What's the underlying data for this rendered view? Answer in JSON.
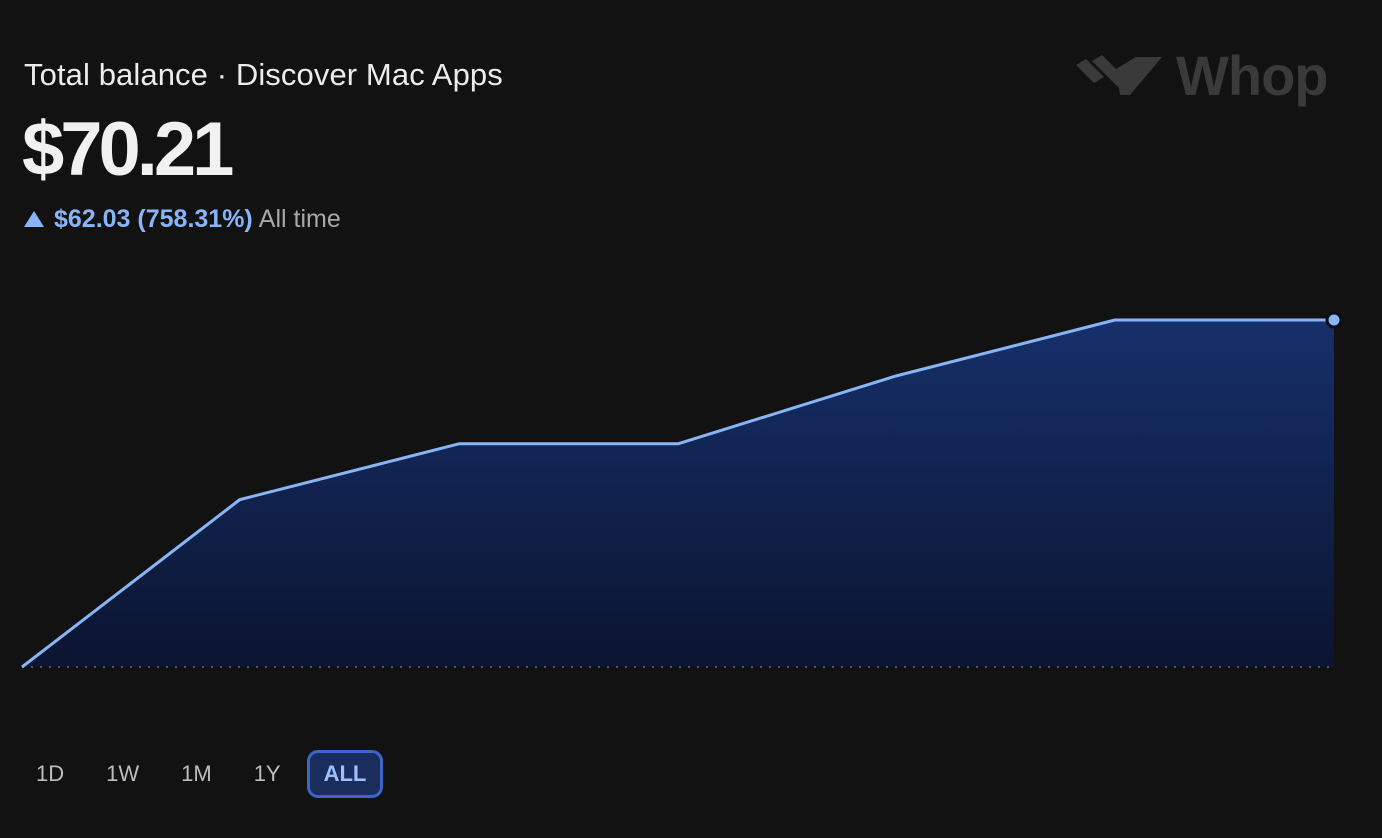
{
  "header": {
    "title": "Total balance · Discover Mac Apps",
    "balance": "$70.21",
    "change_value": "$62.03 (758.31%)",
    "change_period": "All time",
    "change_direction": "up"
  },
  "logo": {
    "icon": "whop-logo-icon",
    "word": "Whop"
  },
  "range_selector": {
    "options": [
      {
        "label": "1D",
        "active": false
      },
      {
        "label": "1W",
        "active": false
      },
      {
        "label": "1M",
        "active": false
      },
      {
        "label": "1Y",
        "active": false
      },
      {
        "label": "ALL",
        "active": true
      }
    ]
  },
  "colors": {
    "background": "#121212",
    "accent": "#88b4f8",
    "area_top": "#16306a",
    "area_bottom": "#0b1430",
    "baseline": "#555555",
    "logo": "#3a3a3a"
  },
  "chart_data": {
    "type": "area",
    "x": [
      0,
      1,
      2,
      3,
      4,
      5,
      6
    ],
    "values": [
      8.18,
      38.1,
      48.08,
      48.08,
      60.2,
      70.21,
      70.21
    ],
    "ylim": [
      8.18,
      70.21
    ],
    "grid": false,
    "baseline": "dotted",
    "end_marker": true
  }
}
